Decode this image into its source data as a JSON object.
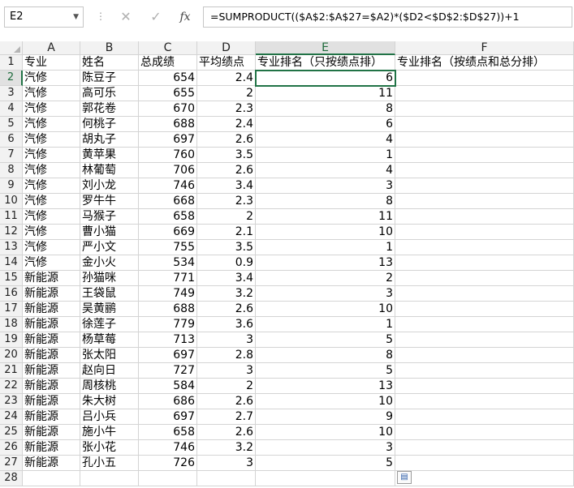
{
  "name_box": "E2",
  "formula": "=SUMPRODUCT(($A$2:$A$27=$A2)*($D2<$D$2:$D$27))+1",
  "icons": {
    "cancel": "✕",
    "enter": "✓",
    "fx": "fx",
    "dropdown": "▼",
    "separator": "⋮",
    "paste_options": "▤"
  },
  "columns": [
    "A",
    "B",
    "C",
    "D",
    "E",
    "F"
  ],
  "rows": [
    {
      "n": "1",
      "a": "专业",
      "b": "姓名",
      "c": "总成绩",
      "d": "平均绩点",
      "e": "专业排名（只按绩点排）",
      "f": "专业排名（按绩点和总分排）"
    },
    {
      "n": "2",
      "a": "汽修",
      "b": "陈豆子",
      "c": "654",
      "d": "2.4",
      "e": "6",
      "f": ""
    },
    {
      "n": "3",
      "a": "汽修",
      "b": "高可乐",
      "c": "655",
      "d": "2",
      "e": "11",
      "f": ""
    },
    {
      "n": "4",
      "a": "汽修",
      "b": "郭花卷",
      "c": "670",
      "d": "2.3",
      "e": "8",
      "f": ""
    },
    {
      "n": "5",
      "a": "汽修",
      "b": "何桃子",
      "c": "688",
      "d": "2.4",
      "e": "6",
      "f": ""
    },
    {
      "n": "6",
      "a": "汽修",
      "b": "胡丸子",
      "c": "697",
      "d": "2.6",
      "e": "4",
      "f": ""
    },
    {
      "n": "7",
      "a": "汽修",
      "b": "黄苹果",
      "c": "760",
      "d": "3.5",
      "e": "1",
      "f": ""
    },
    {
      "n": "8",
      "a": "汽修",
      "b": "林葡萄",
      "c": "706",
      "d": "2.6",
      "e": "4",
      "f": ""
    },
    {
      "n": "9",
      "a": "汽修",
      "b": "刘小龙",
      "c": "746",
      "d": "3.4",
      "e": "3",
      "f": ""
    },
    {
      "n": "10",
      "a": "汽修",
      "b": "罗牛牛",
      "c": "668",
      "d": "2.3",
      "e": "8",
      "f": ""
    },
    {
      "n": "11",
      "a": "汽修",
      "b": "马猴子",
      "c": "658",
      "d": "2",
      "e": "11",
      "f": ""
    },
    {
      "n": "12",
      "a": "汽修",
      "b": "曹小猫",
      "c": "669",
      "d": "2.1",
      "e": "10",
      "f": ""
    },
    {
      "n": "13",
      "a": "汽修",
      "b": "严小文",
      "c": "755",
      "d": "3.5",
      "e": "1",
      "f": ""
    },
    {
      "n": "14",
      "a": "汽修",
      "b": "金小火",
      "c": "534",
      "d": "0.9",
      "e": "13",
      "f": ""
    },
    {
      "n": "15",
      "a": "新能源",
      "b": "孙猫咪",
      "c": "771",
      "d": "3.4",
      "e": "2",
      "f": ""
    },
    {
      "n": "16",
      "a": "新能源",
      "b": "王袋鼠",
      "c": "749",
      "d": "3.2",
      "e": "3",
      "f": ""
    },
    {
      "n": "17",
      "a": "新能源",
      "b": "吴黄鹂",
      "c": "688",
      "d": "2.6",
      "e": "10",
      "f": ""
    },
    {
      "n": "18",
      "a": "新能源",
      "b": "徐莲子",
      "c": "779",
      "d": "3.6",
      "e": "1",
      "f": ""
    },
    {
      "n": "19",
      "a": "新能源",
      "b": "杨草莓",
      "c": "713",
      "d": "3",
      "e": "5",
      "f": ""
    },
    {
      "n": "20",
      "a": "新能源",
      "b": "张太阳",
      "c": "697",
      "d": "2.8",
      "e": "8",
      "f": ""
    },
    {
      "n": "21",
      "a": "新能源",
      "b": "赵向日",
      "c": "727",
      "d": "3",
      "e": "5",
      "f": ""
    },
    {
      "n": "22",
      "a": "新能源",
      "b": "周核桃",
      "c": "584",
      "d": "2",
      "e": "13",
      "f": ""
    },
    {
      "n": "23",
      "a": "新能源",
      "b": "朱大树",
      "c": "686",
      "d": "2.6",
      "e": "10",
      "f": ""
    },
    {
      "n": "24",
      "a": "新能源",
      "b": "吕小兵",
      "c": "697",
      "d": "2.7",
      "e": "9",
      "f": ""
    },
    {
      "n": "25",
      "a": "新能源",
      "b": "施小牛",
      "c": "658",
      "d": "2.6",
      "e": "10",
      "f": ""
    },
    {
      "n": "26",
      "a": "新能源",
      "b": "张小花",
      "c": "746",
      "d": "3.2",
      "e": "3",
      "f": ""
    },
    {
      "n": "27",
      "a": "新能源",
      "b": "孔小五",
      "c": "726",
      "d": "3",
      "e": "5",
      "f": ""
    },
    {
      "n": "28",
      "a": "",
      "b": "",
      "c": "",
      "d": "",
      "e": "",
      "f": ""
    }
  ],
  "active_cell": "E2",
  "colors": {
    "accent": "#217346",
    "header_bg": "#f2f2f2",
    "grid": "#d4d4d4"
  }
}
